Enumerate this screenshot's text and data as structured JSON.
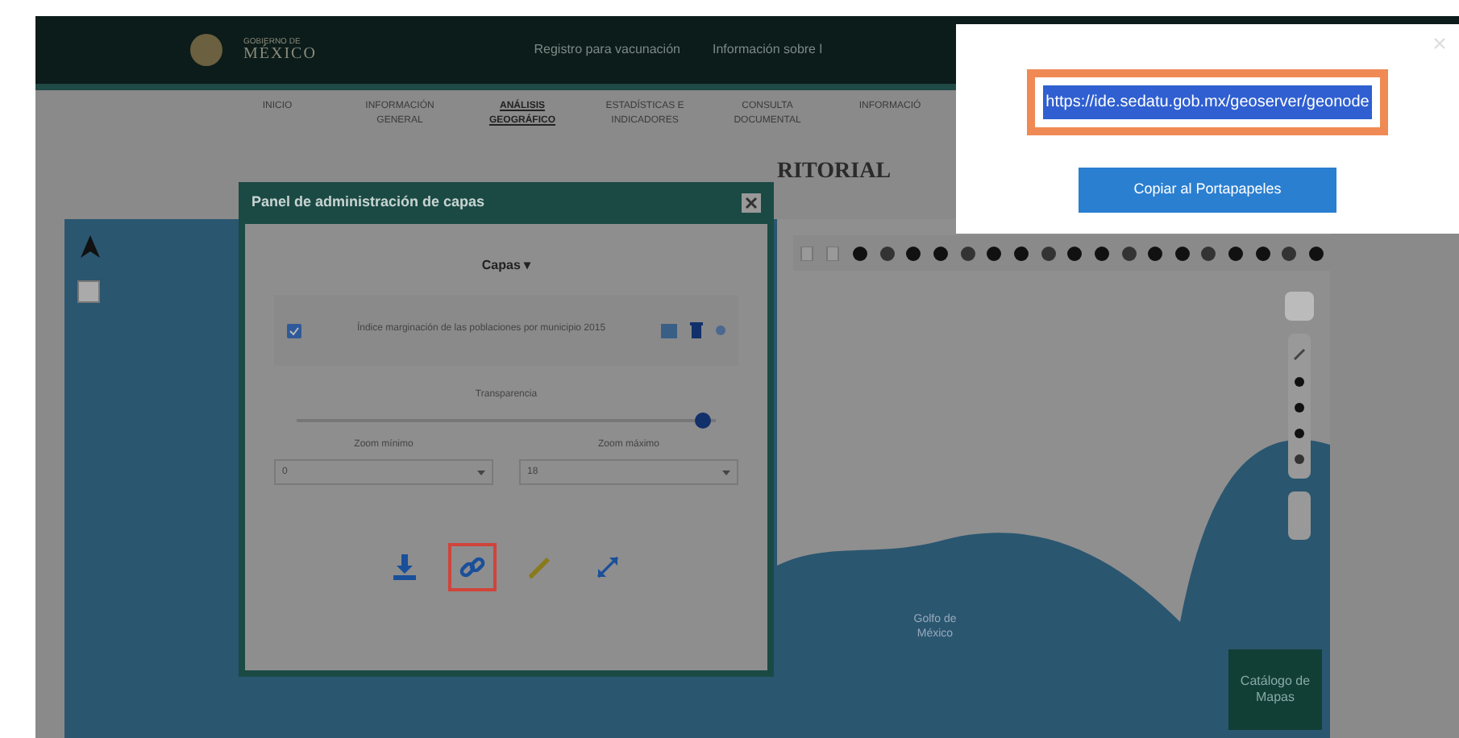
{
  "header": {
    "logo_lines": [
      "GOBIERNO DE",
      "MÉXICO"
    ],
    "links": [
      "Registro para vacunación",
      "Información sobre l"
    ]
  },
  "nav": [
    {
      "label": "INICIO",
      "selected": false
    },
    {
      "label": "INFORMACIÓN GENERAL",
      "selected": false
    },
    {
      "label": "ANÁLISIS GEOGRÁFICO",
      "selected": true
    },
    {
      "label": "ESTADÍSTICAS E INDICADORES",
      "selected": false
    },
    {
      "label": "CONSULTA DOCUMENTAL",
      "selected": false
    },
    {
      "label": "INFORMACIÓ",
      "selected": false
    }
  ],
  "page_title": "RITORIAL",
  "map": {
    "labels": [
      "Golfo de México"
    ],
    "catalog_button": "Catálogo de Mapas"
  },
  "layer_panel": {
    "title": "Panel de administración de capas",
    "tab": "Capas ▾",
    "layer": {
      "name": "Índice marginación de las poblaciones por municipio 2015",
      "visible": true
    },
    "transparency_label": "Transparencia",
    "transparency": {
      "level": 0.97
    },
    "zoom_min": {
      "label": "Zoom mínimo",
      "value": "0"
    },
    "zoom_max": {
      "label": "Zoom máximo",
      "value": "18"
    },
    "actions": [
      {
        "kind": "download",
        "highlighted": false
      },
      {
        "kind": "link",
        "highlighted": true
      },
      {
        "kind": "style",
        "highlighted": false
      },
      {
        "kind": "zoom",
        "highlighted": false
      }
    ]
  },
  "link_popup": {
    "url": "https://ide.sedatu.gob.mx/geoserver/geonode",
    "url_selected": true,
    "highlighted": true,
    "button": "Copiar al Portapapeles"
  }
}
